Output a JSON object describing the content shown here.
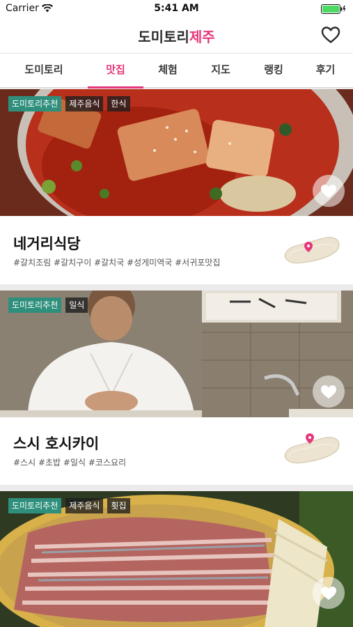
{
  "status_bar": {
    "carrier": "Carrier",
    "time": "5:41 AM"
  },
  "header": {
    "title_part1": "도미토리",
    "title_part2": "제주"
  },
  "tabs": [
    {
      "label": "도미토리",
      "active": false
    },
    {
      "label": "맛집",
      "active": true
    },
    {
      "label": "체험",
      "active": false
    },
    {
      "label": "지도",
      "active": false
    },
    {
      "label": "랭킹",
      "active": false
    },
    {
      "label": "후기",
      "active": false
    }
  ],
  "colors": {
    "accent": "#e5377a",
    "recommend_tag": "#2e8f7c"
  },
  "restaurants": [
    {
      "tags": [
        "도미토리추천",
        "제주음식",
        "한식"
      ],
      "name": "네거리식당",
      "hashtags": "#갈치조림 #갈치구이 #갈치국 #성게미역국 #서귀포맛집"
    },
    {
      "tags": [
        "도미토리추천",
        "일식"
      ],
      "name": "스시 호시카이",
      "hashtags": "#스시 #초밥 #일식 #코스요리"
    },
    {
      "tags": [
        "도미토리추천",
        "제주음식",
        "횟집"
      ]
    }
  ]
}
